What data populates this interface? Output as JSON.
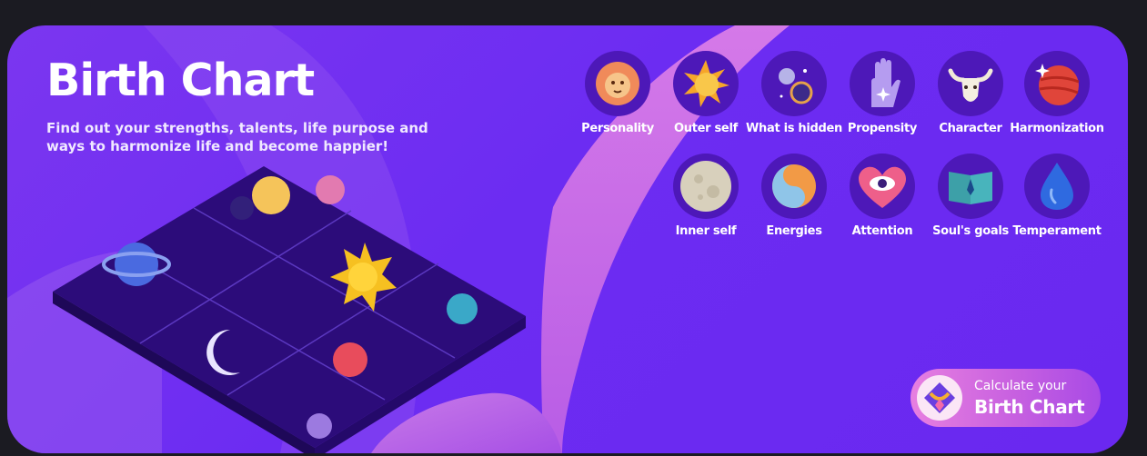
{
  "banner": {
    "title": "Birth Chart",
    "subtitle": "Find out your strengths, talents, life purpose and ways to harmonize life and become happier!"
  },
  "features": [
    {
      "label": "Personality",
      "icon": "lion-icon"
    },
    {
      "label": "Outer self",
      "icon": "sun-icon"
    },
    {
      "label": "What is hidden",
      "icon": "planets-icon"
    },
    {
      "label": "Propensity",
      "icon": "hand-icon"
    },
    {
      "label": "Character",
      "icon": "bull-icon"
    },
    {
      "label": "Harmonization",
      "icon": "planet-icon"
    },
    {
      "label": "Inner self",
      "icon": "moon-icon"
    },
    {
      "label": "Energies",
      "icon": "yin-yang-icon"
    },
    {
      "label": "Attention",
      "icon": "eye-heart-icon"
    },
    {
      "label": "Soul's goals",
      "icon": "book-icon"
    },
    {
      "label": "Temperament",
      "icon": "water-drop-icon"
    }
  ],
  "cta": {
    "line1": "Calculate your",
    "line2": "Birth Chart",
    "icon": "zodiac-badge-icon"
  },
  "colors": {
    "background": "#1b1b22",
    "banner": "#6c2cf2",
    "accent_pink": "#e77fe0",
    "circle": "#4d18b8"
  }
}
